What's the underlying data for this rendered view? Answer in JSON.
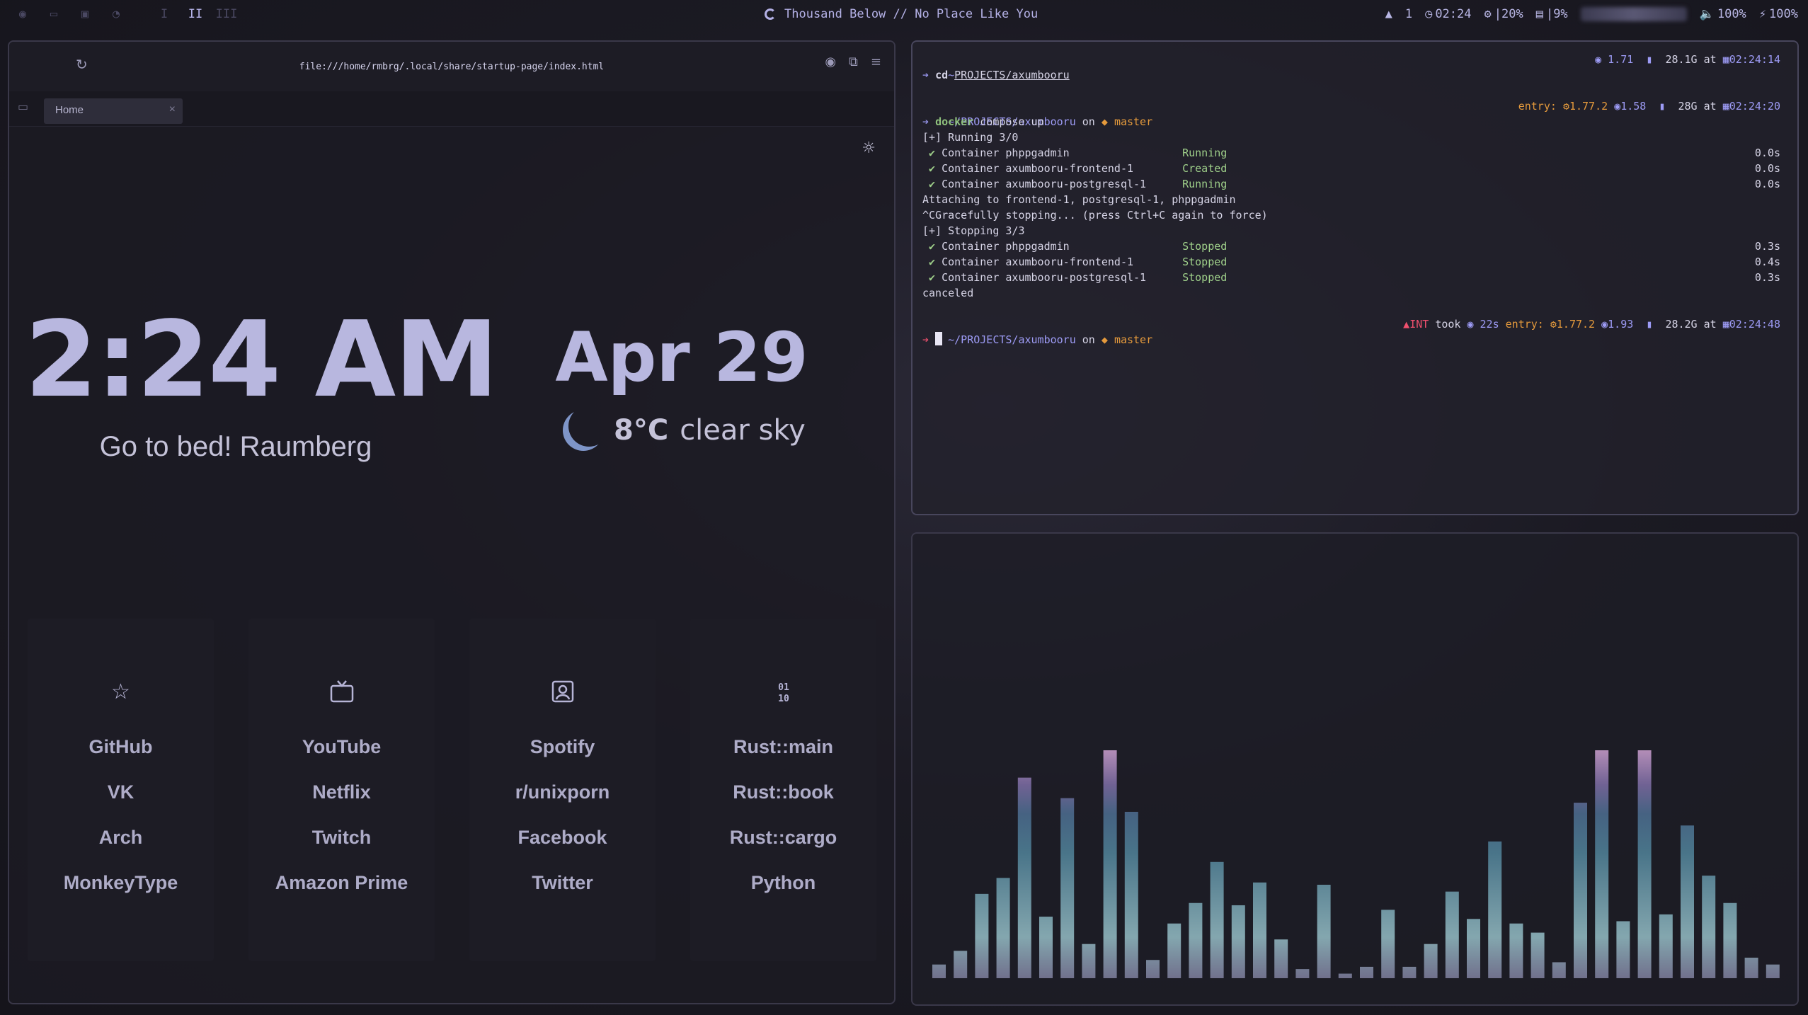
{
  "topbar": {
    "workspaces": [
      "I",
      "II",
      "III"
    ],
    "now_playing": "Thousand Below // No Place Like You",
    "status": {
      "workspace_count": "1",
      "clock": "02:24",
      "cpu": "|20%",
      "mem": "|9%",
      "volume": "100%",
      "battery": "100%"
    }
  },
  "browser": {
    "url": "file:///home/rmbrg/.local/share/startup-page/index.html",
    "tab_label": "Home",
    "clock": "2:24 AM",
    "greeting": "Go to bed! Raumberg",
    "date": "Apr 29",
    "weather": {
      "temp": "8°C",
      "desc": "clear sky"
    },
    "cards": [
      {
        "icon": "star-icon",
        "glyph": "☆",
        "links": [
          "GitHub",
          "VK",
          "Arch",
          "MonkeyType"
        ]
      },
      {
        "icon": "tv-icon",
        "glyph": "📺",
        "links": [
          "YouTube",
          "Netflix",
          "Twitch",
          "Amazon Prime"
        ]
      },
      {
        "icon": "user-portrait-icon",
        "glyph": "👤",
        "links": [
          "Spotify",
          "r/unixporn",
          "Facebook",
          "Twitter"
        ]
      },
      {
        "icon": "binary-icon",
        "glyph": "01\n10",
        "links": [
          "Rust::main",
          "Rust::book",
          "Rust::cargo",
          "Python"
        ]
      }
    ]
  },
  "terminal": {
    "line1": {
      "path": "~",
      "right_load": "1.71",
      "right_mem": "28.1G",
      "right_at": "at",
      "right_time": "02:24:14"
    },
    "cmd1": {
      "prompt": "➔",
      "cmd": "cd",
      "arg": "PROJECTS/axumbooru"
    },
    "line2": {
      "path": "~/PROJECTS/axumbooru",
      "on": "on",
      "branch": "master",
      "entry": "entry:",
      "rust_ver": "1.77.2",
      "load": "1.58",
      "mem": "28G",
      "at": "at",
      "time": "02:24:20"
    },
    "cmd2": {
      "prompt": "➔",
      "cmd": "docker",
      "arg": "compose up"
    },
    "running_header": "[+] Running 3/0",
    "running": [
      {
        "name": "Container phppgadmin",
        "state": "Running",
        "time": "0.0s"
      },
      {
        "name": "Container axumbooru-frontend-1",
        "state": "Created",
        "time": "0.0s"
      },
      {
        "name": "Container axumbooru-postgresql-1",
        "state": "Running",
        "time": "0.0s"
      }
    ],
    "attaching": "Attaching to frontend-1, postgresql-1, phppgadmin",
    "stopping_msg": "^CGracefully stopping... (press Ctrl+C again to force)",
    "stopping_header": "[+] Stopping 3/3",
    "stopped": [
      {
        "name": "Container phppgadmin",
        "state": "Stopped",
        "time": "0.3s"
      },
      {
        "name": "Container axumbooru-frontend-1",
        "state": "Stopped",
        "time": "0.4s"
      },
      {
        "name": "Container axumbooru-postgresql-1",
        "state": "Stopped",
        "time": "0.3s"
      }
    ],
    "canceled": "canceled",
    "line3": {
      "path": "~/PROJECTS/axumbooru",
      "on": "on",
      "branch": "master",
      "int": "INT",
      "took": "took",
      "dur": "22s",
      "entry": "entry:",
      "rust_ver": "1.77.2",
      "load": "1.93",
      "mem": "28.2G",
      "at": "at",
      "time": "02:24:48"
    },
    "prompt": "➔"
  },
  "visualizer": {
    "levels": [
      0.06,
      0.12,
      0.37,
      0.44,
      0.88,
      0.27,
      0.79,
      0.15,
      1.0,
      0.73,
      0.08,
      0.24,
      0.33,
      0.51,
      0.32,
      0.42,
      0.17,
      0.04,
      0.41,
      0.02,
      0.05,
      0.3,
      0.05,
      0.15,
      0.38,
      0.26,
      0.6,
      0.24,
      0.2,
      0.07,
      0.77,
      1.0,
      0.25,
      1.0,
      0.28,
      0.67,
      0.45,
      0.33,
      0.09,
      0.06
    ]
  },
  "colors": {
    "accent": "#9d9bf5",
    "branch": "#e59a3c",
    "ok": "#8ec07c",
    "error": "#f0506e"
  }
}
